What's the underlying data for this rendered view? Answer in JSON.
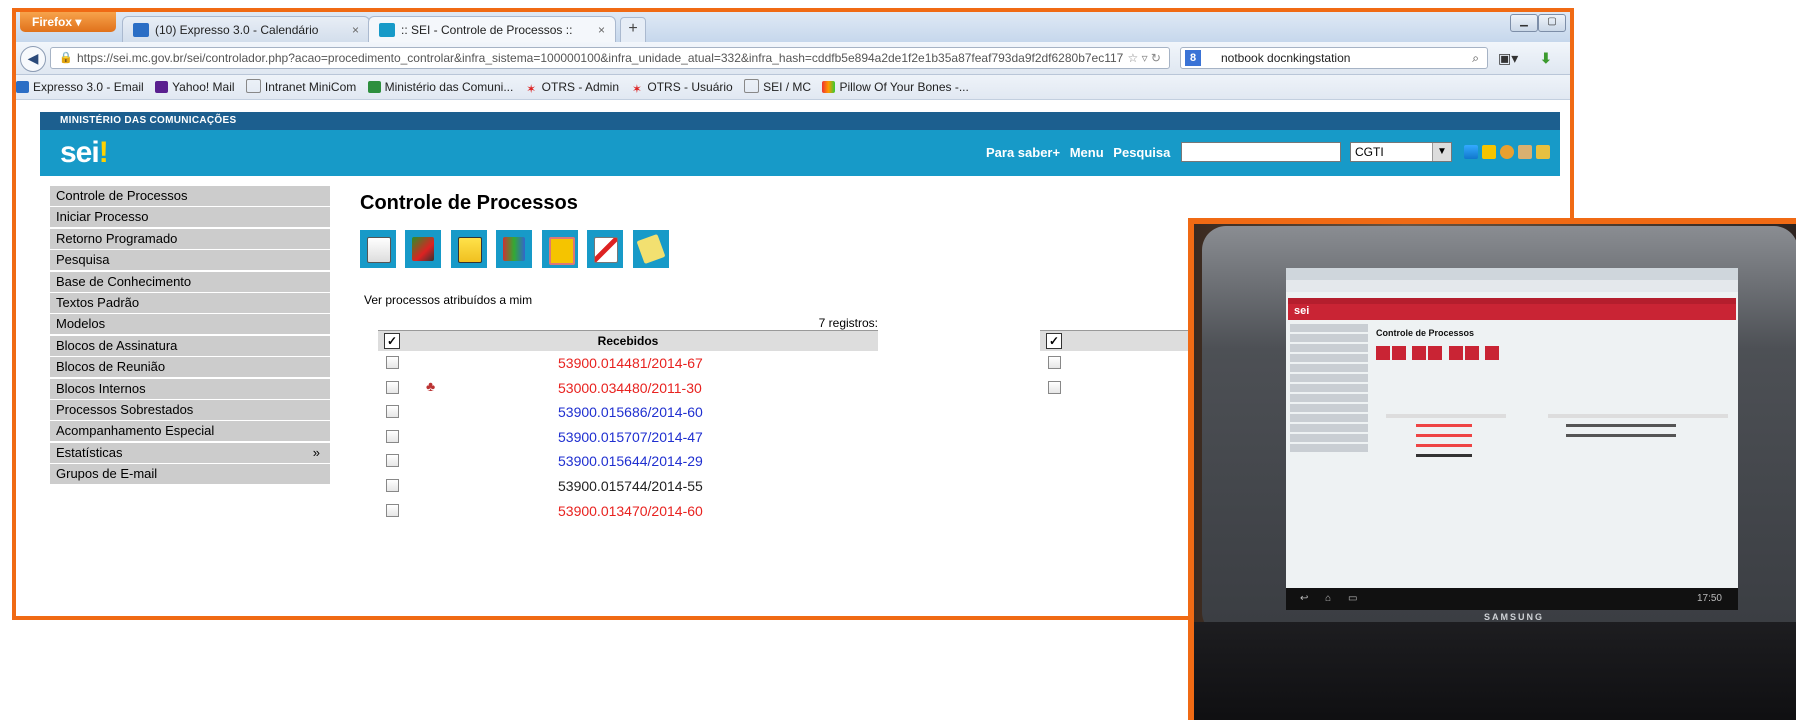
{
  "browser": {
    "firefox_label": "Firefox",
    "tabs": [
      {
        "label": "(10) Expresso 3.0 - Calendário",
        "active": false
      },
      {
        "label": ":: SEI - Controle de Processos ::",
        "active": true
      }
    ],
    "new_tab": "+",
    "url": "https://sei.mc.gov.br/sei/controlador.php?acao=procedimento_controlar&infra_sistema=100000100&infra_unidade_atual=332&infra_hash=cddfb5e894a2de1f2e1b35a87feaf793da9f2df6280b7ec117",
    "search_value": "notbook docnkingstation",
    "bookmarks": [
      "Expresso 3.0 - Email",
      "Yahoo! Mail",
      "Intranet MiniCom",
      "Ministério das Comuni...",
      "OTRS - Admin",
      "OTRS - Usuário",
      "SEI / MC",
      "Pillow Of Your Bones -..."
    ]
  },
  "sei": {
    "ministry": "MINISTÉRIO DAS COMUNICAÇÕES",
    "logo": "sei",
    "logo_dot": "!",
    "header_links": {
      "para_saber": "Para saber+",
      "menu": "Menu",
      "pesquisa": "Pesquisa"
    },
    "unit_select": "CGTI",
    "sidebar": [
      {
        "label": "Controle de Processos"
      },
      {
        "label": "Iniciar Processo"
      },
      {
        "label": "Retorno Programado"
      },
      {
        "label": "Pesquisa"
      },
      {
        "label": "Base de Conhecimento"
      },
      {
        "label": "Textos Padrão"
      },
      {
        "label": "Modelos"
      },
      {
        "label": "Blocos de Assinatura"
      },
      {
        "label": "Blocos de Reunião"
      },
      {
        "label": "Blocos Internos"
      },
      {
        "label": "Processos Sobrestados"
      },
      {
        "label": "Acompanhamento Especial"
      },
      {
        "label": "Estatísticas",
        "more": "»"
      },
      {
        "label": "Grupos de E-mail"
      }
    ],
    "page_title": "Controle de Processos",
    "link_assigned": "Ver processos atribuídos a mim",
    "recebidos": {
      "count_label": "7 registros:",
      "header": "Recebidos",
      "rows": [
        {
          "number": "53900.014481/2014-67",
          "color": "#e8221f",
          "flag": false
        },
        {
          "number": "53000.034480/2011-30",
          "color": "#e8221f",
          "flag": true
        },
        {
          "number": "53900.015686/2014-60",
          "color": "#1f2fd0",
          "flag": false
        },
        {
          "number": "53900.015707/2014-47",
          "color": "#1f2fd0",
          "flag": false
        },
        {
          "number": "53900.015644/2014-29",
          "color": "#1f2fd0",
          "flag": false
        },
        {
          "number": "53900.015744/2014-55",
          "color": "#222222",
          "flag": false
        },
        {
          "number": "53900.013470/2014-60",
          "color": "#e8221f",
          "flag": false
        }
      ]
    }
  },
  "tablet": {
    "screen_title": "Controle de Processos",
    "clock": "17:50",
    "brand": "SAMSUNG"
  },
  "colors": {
    "accent_orange": "#f06a14",
    "sei_blue": "#179ac8",
    "sei_dark_blue": "#1c5f8f",
    "sei_red": "#c92434"
  }
}
